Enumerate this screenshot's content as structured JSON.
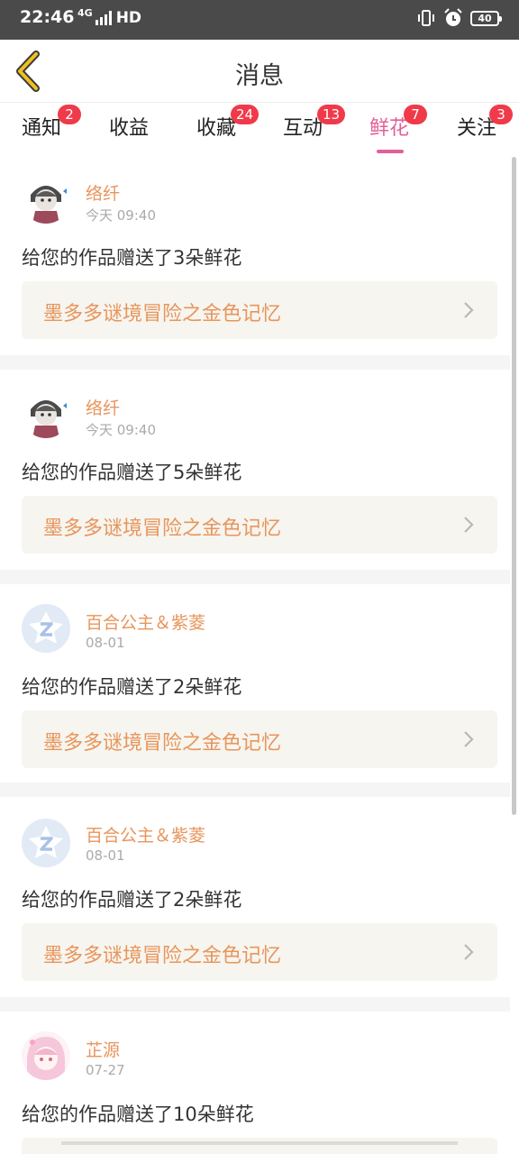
{
  "status_bar": {
    "time": "22:46",
    "network": "4G",
    "hd": "HD",
    "battery": "40"
  },
  "header": {
    "title": "消息"
  },
  "tabs": [
    {
      "label": "通知",
      "badge": "2"
    },
    {
      "label": "收益",
      "badge": ""
    },
    {
      "label": "收藏",
      "badge": "24"
    },
    {
      "label": "互动",
      "badge": "13"
    },
    {
      "label": "鲜花",
      "badge": "7",
      "active": true
    },
    {
      "label": "关注",
      "badge": "3"
    }
  ],
  "feed": [
    {
      "name": "络纤",
      "time": "今天 09:40",
      "message": "给您的作品赠送了3朵鲜花",
      "work": "墨多多谜境冒险之金色记忆",
      "avatar": "anime-avatar"
    },
    {
      "name": "络纤",
      "time": "今天 09:40",
      "message": "给您的作品赠送了5朵鲜花",
      "work": "墨多多谜境冒险之金色记忆",
      "avatar": "anime-avatar"
    },
    {
      "name": "百合公主＆紫菱",
      "time": "08-01",
      "message": "给您的作品赠送了2朵鲜花",
      "work": "墨多多谜境冒险之金色记忆",
      "avatar": "default-avatar"
    },
    {
      "name": "百合公主＆紫菱",
      "time": "08-01",
      "message": "给您的作品赠送了2朵鲜花",
      "work": "墨多多谜境冒险之金色记忆",
      "avatar": "default-avatar"
    },
    {
      "name": "芷源",
      "time": "07-27",
      "message": "给您的作品赠送了10朵鲜花",
      "work": "",
      "avatar": "pink-anime-avatar"
    }
  ],
  "colors": {
    "accent": "#e2609a",
    "name": "#e8955c",
    "badge": "#f03a4a",
    "back_icon": "#f0c020"
  },
  "icons": [
    "back-arrow-icon",
    "vibrate-icon",
    "alarm-icon",
    "chevron-right-icon"
  ]
}
